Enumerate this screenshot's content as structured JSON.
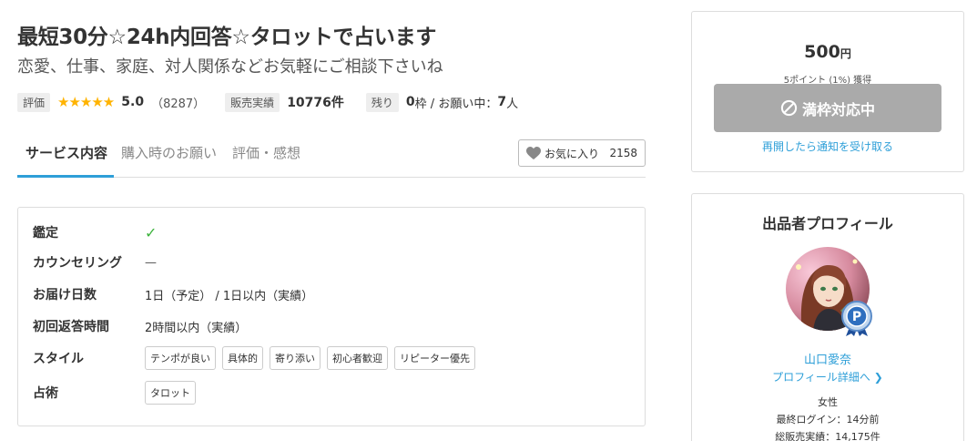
{
  "header": {
    "title": "最短30分☆24h内回答☆タロットで占います",
    "subtitle": "恋愛、仕事、家庭、対人関係などお気軽にご相談下さいね"
  },
  "meta": {
    "rating_tag": "評価",
    "stars": "★★★★★",
    "rating_value": "5.0",
    "review_count": "（8287）",
    "sales_tag": "販売実績",
    "sales_value": "10776件",
    "remaining_tag": "残り",
    "slots_value": "0",
    "slots_unit": "枠 / お願い中：",
    "requests_value": "7",
    "requests_unit": "人"
  },
  "tabs": [
    {
      "label": "サービス内容"
    },
    {
      "label": "購入時のお願い"
    },
    {
      "label": "評価・感想"
    }
  ],
  "favorite": {
    "label": "お気に入り",
    "count": "2158"
  },
  "spec": {
    "rows": [
      {
        "label": "鑑定",
        "value": "✓"
      },
      {
        "label": "カウンセリング",
        "value": "—"
      },
      {
        "label": "お届け日数",
        "value": "1日（予定） / 1日以内（実績）"
      },
      {
        "label": "初回返答時間",
        "value": "2時間以内（実績）"
      },
      {
        "label": "スタイル",
        "chips": [
          "テンポが良い",
          "具体的",
          "寄り添い",
          "初心者歓迎",
          "リピーター優先"
        ]
      },
      {
        "label": "占術",
        "chips": [
          "タロット"
        ]
      }
    ]
  },
  "purchase": {
    "price": "500",
    "currency": "円",
    "points": "5ポイント (1%) 獲得",
    "button_label": "満枠対応中",
    "notify_link": "再開したら通知を受け取る"
  },
  "profile": {
    "title": "出品者プロフィール",
    "name": "山口愛奈",
    "detail_link": "プロフィール詳細へ",
    "gender": "女性",
    "last_login": "最終ログイン：14分前",
    "total_sales": "総販売実績：14,175件"
  },
  "colors": {
    "accent": "#2e9fd8",
    "star": "#ffb300",
    "check": "#3db33d",
    "disabled_button": "#aaaaaa"
  },
  "icons": {
    "favorite": "heart-icon",
    "button": "prohibited-icon",
    "check": "check-icon",
    "link": "chevron-right-icon",
    "badge": "pro-badge-icon"
  }
}
